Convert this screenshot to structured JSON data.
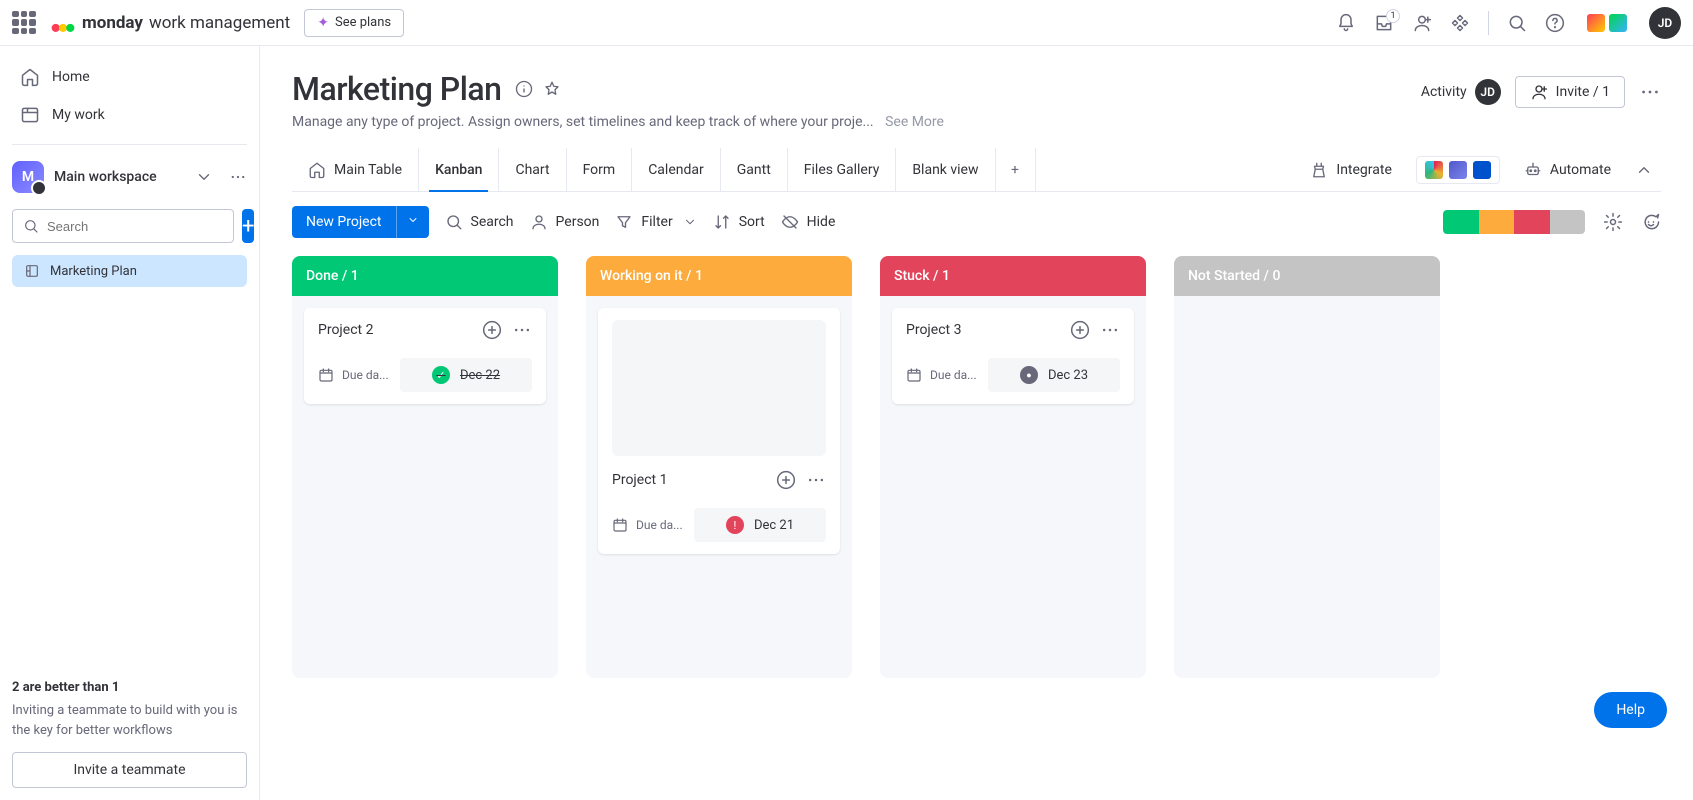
{
  "topbar": {
    "brand_bold": "monday",
    "brand_sub": "work management",
    "see_plans": "See plans",
    "inbox_badge": "1"
  },
  "sidebar": {
    "home": "Home",
    "mywork": "My work",
    "workspace_initial": "M",
    "workspace_name": "Main workspace",
    "search_placeholder": "Search",
    "board_name": "Marketing Plan",
    "promo_title": "2 are better than 1",
    "promo_body": "Inviting a teammate to build with you is the key for better workflows",
    "invite_btn": "Invite a teammate"
  },
  "header": {
    "title": "Marketing Plan",
    "desc": "Manage any type of project. Assign owners, set timelines and keep track of where your proje...",
    "see_more": "See More",
    "activity": "Activity",
    "invite": "Invite / 1"
  },
  "tabs": {
    "items": [
      "Main Table",
      "Kanban",
      "Chart",
      "Form",
      "Calendar",
      "Gantt",
      "Files Gallery",
      "Blank view"
    ],
    "integrate": "Integrate",
    "automate": "Automate"
  },
  "toolbar": {
    "new_project": "New Project",
    "search": "Search",
    "person": "Person",
    "filter": "Filter",
    "sort": "Sort",
    "hide": "Hide",
    "pill_colors": [
      "#00c875",
      "#fdab3d",
      "#e2445c",
      "#c4c4c4"
    ]
  },
  "kanban": {
    "due_label": "Due da...",
    "columns": [
      {
        "title": "Done / 1",
        "color": "#00c875"
      },
      {
        "title": "Working on it / 1",
        "color": "#fdab3d"
      },
      {
        "title": "Stuck / 1",
        "color": "#e2445c"
      },
      {
        "title": "Not Started / 0",
        "color": "#c4c4c4"
      }
    ],
    "cards": {
      "project2": {
        "title": "Project 2",
        "date": "Dec 22"
      },
      "project1": {
        "title": "Project 1",
        "date": "Dec 21"
      },
      "project3": {
        "title": "Project 3",
        "date": "Dec 23"
      }
    }
  },
  "help": "Help"
}
